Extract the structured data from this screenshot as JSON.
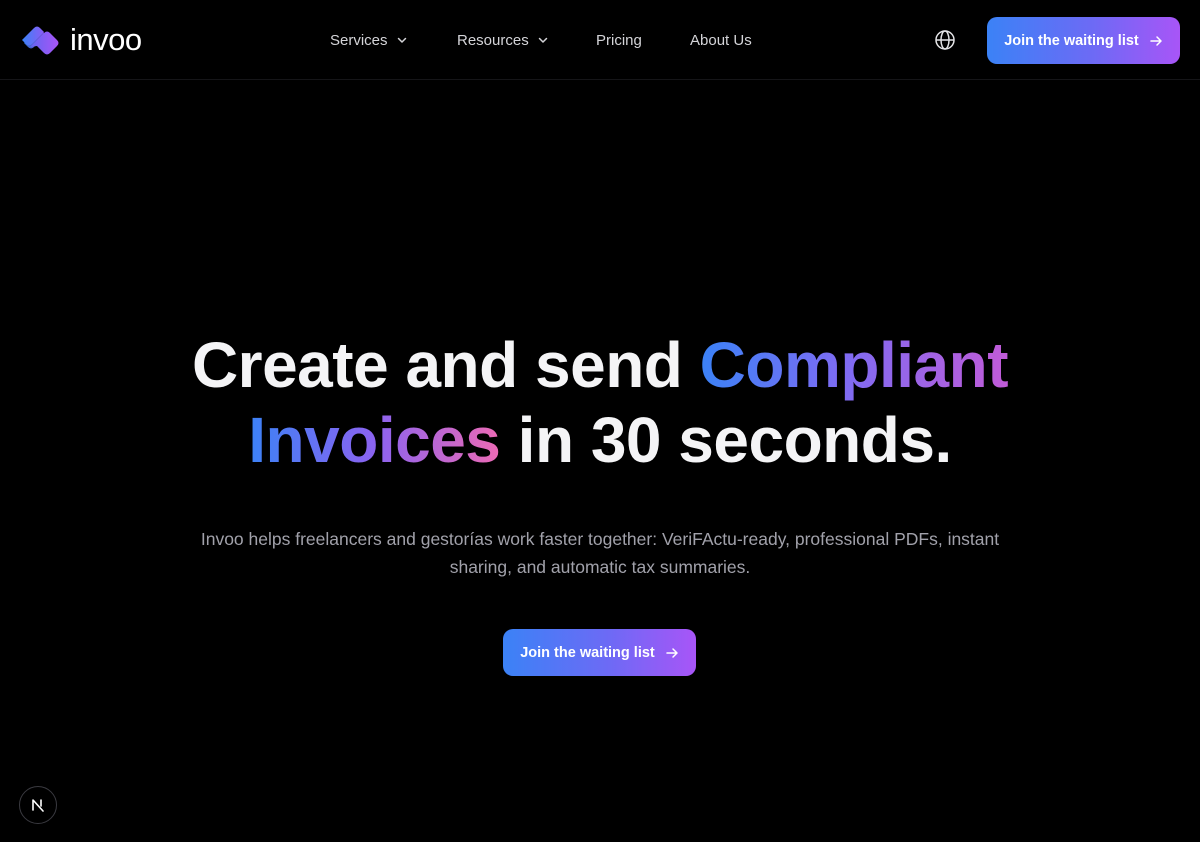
{
  "brand": {
    "name": "invoo",
    "logo_colors": [
      "#3b82f6",
      "#8b5cf6"
    ]
  },
  "nav": {
    "items": [
      {
        "label": "Services",
        "icon": "chevron-down-icon"
      },
      {
        "label": "Resources",
        "icon": "chevron-down-icon"
      },
      {
        "label": "Pricing"
      },
      {
        "label": "About Us"
      }
    ],
    "language_icon": "globe-icon",
    "cta_label": "Join the waiting list",
    "cta_icon": "arrow-right-icon"
  },
  "hero": {
    "title_part1": "Create and send ",
    "title_highlight1": "Compliant",
    "title_highlight2": "Invoices",
    "title_part2": " in 30 seconds.",
    "subtitle": "Invoo helps freelancers and gestorías work faster together: VeriFActu-ready, professional PDFs, instant sharing, and automatic tax summaries.",
    "cta_label": "Join the waiting list",
    "cta_icon": "arrow-right-icon"
  },
  "dev_badge": {
    "label": "N",
    "icon": "nextjs-icon"
  },
  "colors": {
    "background": "#000000",
    "text_primary": "#f4f4f6",
    "text_secondary": "#a1a1aa",
    "accent_start": "#3b82f6",
    "accent_mid": "#8b5cf6",
    "accent_end": "#ec4899"
  }
}
